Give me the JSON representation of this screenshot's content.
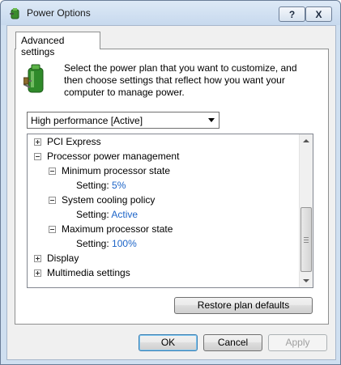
{
  "window": {
    "title": "Power Options",
    "help_label": "?",
    "close_label": "X"
  },
  "tab": {
    "label": "Advanced settings"
  },
  "intro_text": "Select the power plan that you want to customize, and then choose settings that reflect how you want your computer to manage power.",
  "plan_select": {
    "value": "High performance [Active]"
  },
  "tree": {
    "items": [
      {
        "label": "PCI Express",
        "state": "collapsed"
      },
      {
        "label": "Processor power management",
        "state": "expanded"
      },
      {
        "label": "Minimum processor state",
        "state": "expanded"
      },
      {
        "setting_label": "Setting:",
        "value": "5%"
      },
      {
        "label": "System cooling policy",
        "state": "expanded"
      },
      {
        "setting_label": "Setting:",
        "value": "Active"
      },
      {
        "label": "Maximum processor state",
        "state": "expanded"
      },
      {
        "setting_label": "Setting:",
        "value": "100%"
      },
      {
        "label": "Display",
        "state": "collapsed"
      },
      {
        "label": "Multimedia settings",
        "state": "collapsed"
      }
    ]
  },
  "buttons": {
    "restore": "Restore plan defaults",
    "ok": "OK",
    "cancel": "Cancel",
    "apply": "Apply"
  },
  "colors": {
    "setting_value": "#1c64c8",
    "title_bar": "#c7d9ee"
  }
}
